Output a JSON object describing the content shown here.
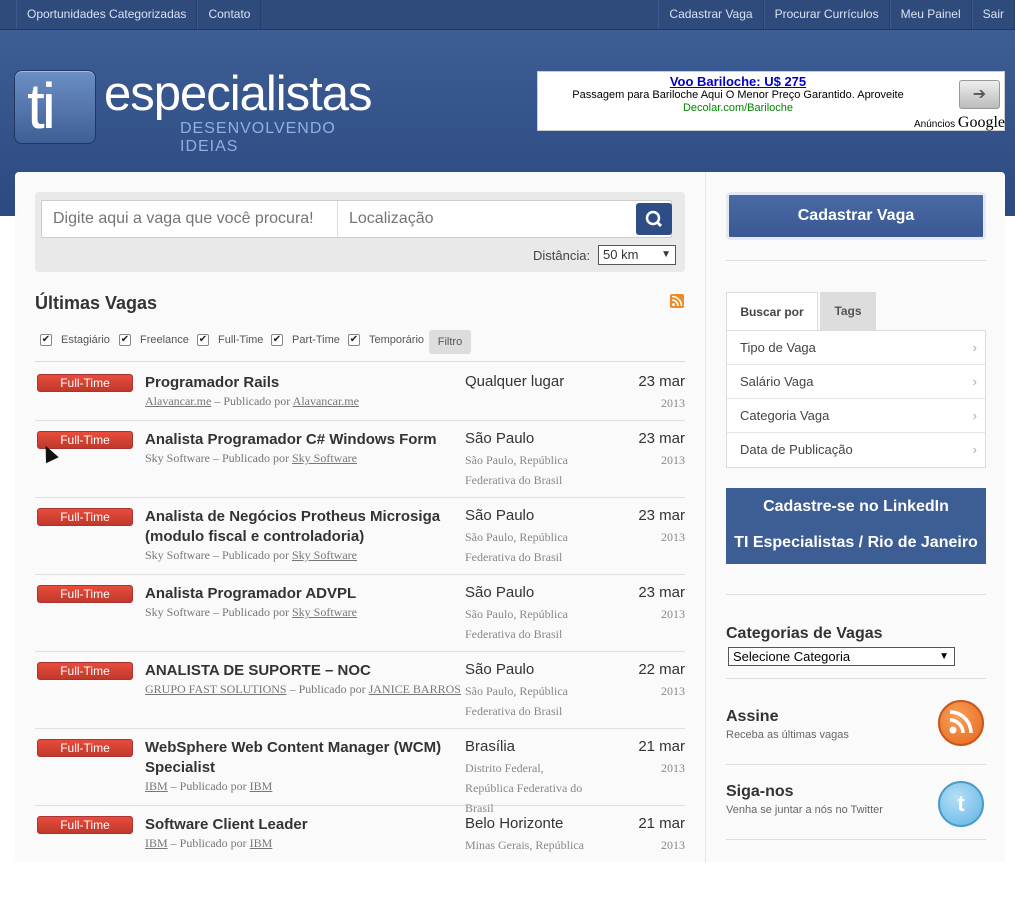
{
  "topnav": {
    "left": [
      "Oportunidades Categorizadas",
      "Contato"
    ],
    "right": [
      "Cadastrar Vaga",
      "Procurar Currículos",
      "Meu Painel",
      "Sair"
    ]
  },
  "logo": {
    "ti": "ti",
    "name": "especialistas",
    "tagline": "DESENVOLVENDO IDEIAS"
  },
  "ad": {
    "title": "Voo Bariloche: U$ 275",
    "text": "Passagem para Bariloche Aqui O Menor Preço Garantido. Aproveite",
    "url": "Decolar.com/Bariloche",
    "button": "➔",
    "label": "Anúncios",
    "brand": "Google"
  },
  "search": {
    "query_placeholder": "Digite aqui a vaga que você procura!",
    "location_placeholder": "Localização",
    "distance_label": "Distância:",
    "distance_value": "50 km"
  },
  "jobs_section": {
    "title": "Últimas Vagas",
    "filters": [
      "Estagiário",
      "Freelance",
      "Full-Time",
      "Part-Time",
      "Temporário"
    ],
    "filter_button": "Filtro"
  },
  "jobs": [
    {
      "type": "Full-Time",
      "title": "Programador Rails",
      "company": "Alavancar.me",
      "by": "– Publicado por",
      "poster": "Alavancar.me",
      "location": "Qualquer lugar",
      "location_detail": "",
      "date": "23 mar",
      "year": "2013",
      "company_link": true
    },
    {
      "type": "Full-Time",
      "title": "Analista Programador C# Windows Form",
      "company": "Sky Software",
      "by": "– Publicado por",
      "poster": "Sky Software",
      "location": "São Paulo",
      "location_detail": "São Paulo, República Federativa do Brasil",
      "date": "23 mar",
      "year": "2013",
      "company_link": false
    },
    {
      "type": "Full-Time",
      "title": "Analista de Negócios Protheus Microsiga (modulo fiscal e controladoria)",
      "company": "Sky Software",
      "by": "– Publicado por",
      "poster": "Sky Software",
      "location": "São Paulo",
      "location_detail": "São Paulo, República Federativa do Brasil",
      "date": "23 mar",
      "year": "2013",
      "company_link": false
    },
    {
      "type": "Full-Time",
      "title": "Analista Programador ADVPL",
      "company": "Sky Software",
      "by": "– Publicado por",
      "poster": "Sky Software",
      "location": "São Paulo",
      "location_detail": "São Paulo, República Federativa do Brasil",
      "date": "23 mar",
      "year": "2013",
      "company_link": false
    },
    {
      "type": "Full-Time",
      "title": "ANALISTA DE SUPORTE – NOC",
      "company": "GRUPO FAST SOLUTIONS",
      "by": "– Publicado por",
      "poster": "JANICE BARROS",
      "location": "São Paulo",
      "location_detail": "São Paulo, República Federativa do Brasil",
      "date": "22 mar",
      "year": "2013",
      "company_link": true
    },
    {
      "type": "Full-Time",
      "title": "WebSphere Web Content Manager (WCM) Specialist",
      "company": "IBM",
      "by": "– Publicado por",
      "poster": "IBM",
      "location": "Brasília",
      "location_detail": "Distrito Federal, República Federativa do Brasil",
      "date": "21 mar",
      "year": "2013",
      "company_link": true
    },
    {
      "type": "Full-Time",
      "title": "Software Client Leader",
      "company": "IBM",
      "by": "– Publicado por",
      "poster": "IBM",
      "location": "Belo Horizonte",
      "location_detail": "Minas Gerais, República",
      "date": "21 mar",
      "year": "2013",
      "company_link": true
    }
  ],
  "sidebar": {
    "cta": "Cadastrar Vaga",
    "tabs": [
      "Buscar por",
      "Tags"
    ],
    "menu": [
      "Tipo de Vaga",
      "Salário Vaga",
      "Categoria Vaga",
      "Data de Publicação"
    ],
    "linkedin": [
      "Cadastre-se no LinkedIn",
      "TI Especialistas / Rio de Janeiro"
    ],
    "categories_title": "Categorias de Vagas",
    "categories_select": "Selecione Categoria",
    "subscribe_title": "Assine",
    "subscribe_sub": "Receba as últimas vagas",
    "follow_title": "Siga-nos",
    "follow_sub": "Venha se juntar a nós no Twitter"
  },
  "colors": {
    "header": "#2f4b7c",
    "badge": "#d9342b",
    "cta": "#3d5d95"
  }
}
